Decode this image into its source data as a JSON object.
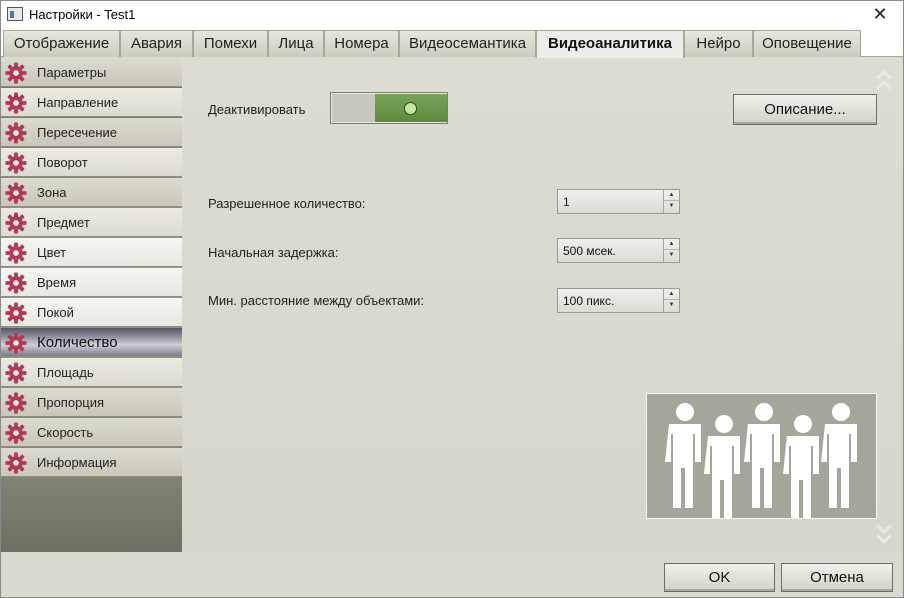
{
  "window": {
    "title": "Настройки - Test1",
    "close_symbol": "✕"
  },
  "tabs": [
    {
      "label": "Отображение",
      "active": false
    },
    {
      "label": "Авария",
      "active": false
    },
    {
      "label": "Помехи",
      "active": false
    },
    {
      "label": "Лица",
      "active": false
    },
    {
      "label": "Номера",
      "active": false
    },
    {
      "label": "Видеосемантика",
      "active": false
    },
    {
      "label": "Видеоаналитика",
      "active": true
    },
    {
      "label": "Нейро",
      "active": false
    },
    {
      "label": "Оповещение",
      "active": false
    }
  ],
  "sidebar": {
    "icon": "gear-icon",
    "items": [
      {
        "label": "Параметры"
      },
      {
        "label": "Направление"
      },
      {
        "label": "Пересечение"
      },
      {
        "label": "Поворот"
      },
      {
        "label": "Зона"
      },
      {
        "label": "Предмет"
      },
      {
        "label": "Цвет"
      },
      {
        "label": "Время"
      },
      {
        "label": "Покой"
      },
      {
        "label": "Количество",
        "selected": true
      },
      {
        "label": "Площадь"
      },
      {
        "label": "Пропорция"
      },
      {
        "label": "Скорость"
      },
      {
        "label": "Информация"
      }
    ]
  },
  "main": {
    "deactivate_label": "Деактивировать",
    "deactivate_toggle_on": true,
    "description_button": "Описание...",
    "fields": [
      {
        "label": "Разрешенное количество:",
        "value": "1"
      },
      {
        "label": "Начальная задержка:",
        "value": "500 мсек."
      },
      {
        "label": "Мин. расстояние между объектами:",
        "value": "100 пикс."
      }
    ],
    "illustration_icon": "people-group-icon"
  },
  "footer": {
    "ok_label": "OK",
    "cancel_label": "Отмена"
  },
  "colors": {
    "gear": "#b03a55",
    "toggle_on": "#6b9a4a",
    "panel_bg": "#d9d9d0"
  }
}
